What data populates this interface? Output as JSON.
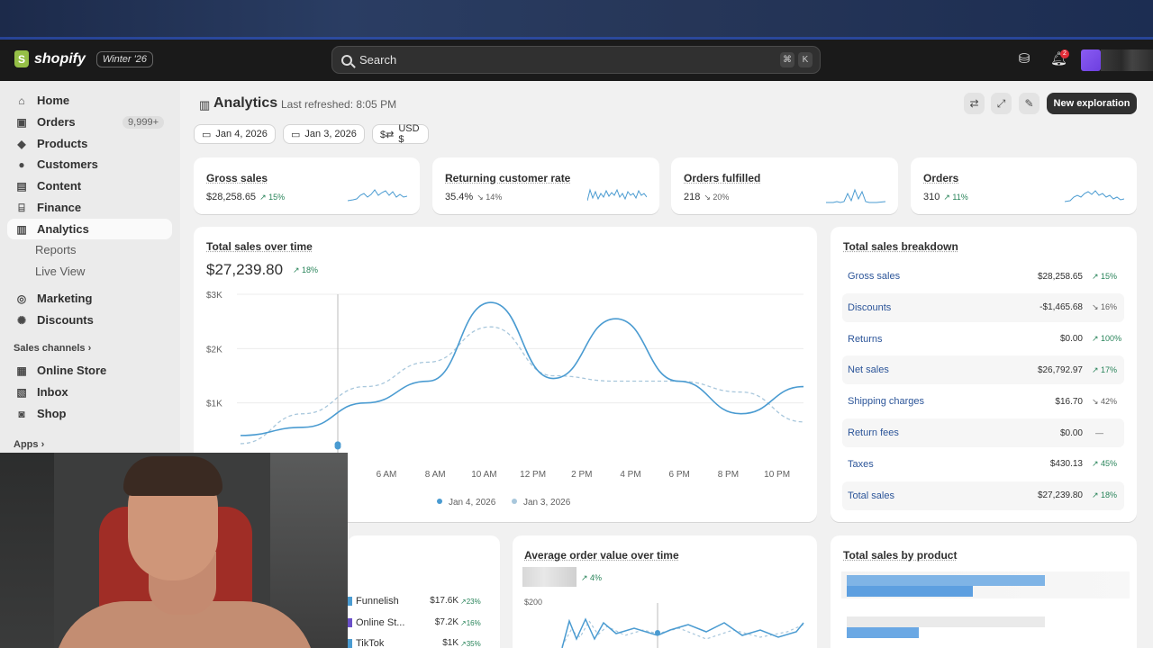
{
  "topbar": {
    "brand": "shopify",
    "badge": "Winter '26",
    "search_placeholder": "Search",
    "search_kbd_1": "⌘",
    "search_kbd_2": "K",
    "notification_count": "2"
  },
  "sidebar": {
    "items": [
      {
        "label": "Home",
        "icon": "home-icon"
      },
      {
        "label": "Orders",
        "icon": "orders-icon",
        "count": "9,999+"
      },
      {
        "label": "Products",
        "icon": "tag-icon"
      },
      {
        "label": "Customers",
        "icon": "person-icon"
      },
      {
        "label": "Content",
        "icon": "content-icon"
      },
      {
        "label": "Finance",
        "icon": "bank-icon"
      },
      {
        "label": "Analytics",
        "icon": "chart-bar-icon"
      },
      {
        "label": "Reports"
      },
      {
        "label": "Live View"
      },
      {
        "label": "Marketing",
        "icon": "target-icon"
      },
      {
        "label": "Discounts",
        "icon": "discount-icon"
      }
    ],
    "sales_channels_label": "Sales channels",
    "channels": [
      {
        "label": "Online Store",
        "icon": "store-icon"
      },
      {
        "label": "Inbox",
        "icon": "inbox-icon"
      },
      {
        "label": "Shop",
        "icon": "shop-icon"
      }
    ],
    "apps_label": "Apps"
  },
  "header": {
    "title": "Analytics",
    "last_refreshed": "Last refreshed: 8:05 PM",
    "new_exploration": "New exploration"
  },
  "filters": {
    "date": "Jan 4, 2026",
    "compare": "Jan 3, 2026",
    "currency": "USD $"
  },
  "kpis": [
    {
      "title": "Gross sales",
      "value": "$28,258.65",
      "delta": "15%",
      "dir": "up"
    },
    {
      "title": "Returning customer rate",
      "value": "35.4%",
      "delta": "14%",
      "dir": "down"
    },
    {
      "title": "Orders fulfilled",
      "value": "218",
      "delta": "20%",
      "dir": "down"
    },
    {
      "title": "Orders",
      "value": "310",
      "delta": "11%",
      "dir": "up"
    }
  ],
  "sales_over_time": {
    "title": "Total sales over time",
    "total": "$27,239.80",
    "delta": "18%",
    "chart_data": {
      "type": "line",
      "x": [
        "4 AM",
        "6 AM",
        "8 AM",
        "10 AM",
        "12 PM",
        "2 PM",
        "4 PM",
        "6 PM",
        "8 PM",
        "10 PM"
      ],
      "y_ticks": [
        "$3K",
        "$2K",
        "$1K"
      ],
      "ylim": [
        0,
        3000
      ],
      "series": [
        {
          "name": "Jan 4, 2026",
          "color": "#4a9bd1",
          "values": [
            400,
            550,
            1000,
            1400,
            2850,
            1450,
            2550,
            1400,
            800,
            1300
          ]
        },
        {
          "name": "Jan 3, 2026",
          "color": "#a8c7dc",
          "values": [
            250,
            800,
            1300,
            1750,
            2400,
            1500,
            1400,
            1400,
            1200,
            650
          ]
        }
      ]
    }
  },
  "breakdown": {
    "title": "Total sales breakdown",
    "rows": [
      {
        "label": "Gross sales",
        "value": "$28,258.65",
        "delta": "15%",
        "dir": "up"
      },
      {
        "label": "Discounts",
        "value": "-$1,465.68",
        "delta": "16%",
        "dir": "down"
      },
      {
        "label": "Returns",
        "value": "$0.00",
        "delta": "100%",
        "dir": "up"
      },
      {
        "label": "Net sales",
        "value": "$26,792.97",
        "delta": "17%",
        "dir": "up"
      },
      {
        "label": "Shipping charges",
        "value": "$16.70",
        "delta": "42%",
        "dir": "down"
      },
      {
        "label": "Return fees",
        "value": "$0.00",
        "delta": "—",
        "dir": "none"
      },
      {
        "label": "Taxes",
        "value": "$430.13",
        "delta": "45%",
        "dir": "up"
      },
      {
        "label": "Total sales",
        "value": "$27,239.80",
        "delta": "18%",
        "dir": "up"
      }
    ]
  },
  "channels_card": {
    "rows": [
      {
        "label": "Funnelish",
        "value": "$17.6K",
        "delta": "23%",
        "color": "#4a9bd1"
      },
      {
        "label": "Online St...",
        "value": "$7.2K",
        "delta": "16%",
        "color": "#6a4fc8"
      },
      {
        "label": "TikTok",
        "value": "$1K",
        "delta": "35%",
        "color": "#4a9bd1"
      }
    ]
  },
  "aov": {
    "title": "Average order value over time",
    "delta": "4%",
    "y_tick": "$200",
    "chart_data": {
      "type": "line",
      "y_ticks": [
        "$200"
      ],
      "series": [
        {
          "name": "Jan 4, 2026",
          "color": "#4a9bd1"
        },
        {
          "name": "Jan 3, 2026",
          "color": "#a8c7dc"
        }
      ]
    }
  },
  "by_product": {
    "title": "Total sales by product"
  },
  "colors": {
    "accent": "#303030",
    "positive": "#29845a",
    "link": "#2c5599"
  }
}
